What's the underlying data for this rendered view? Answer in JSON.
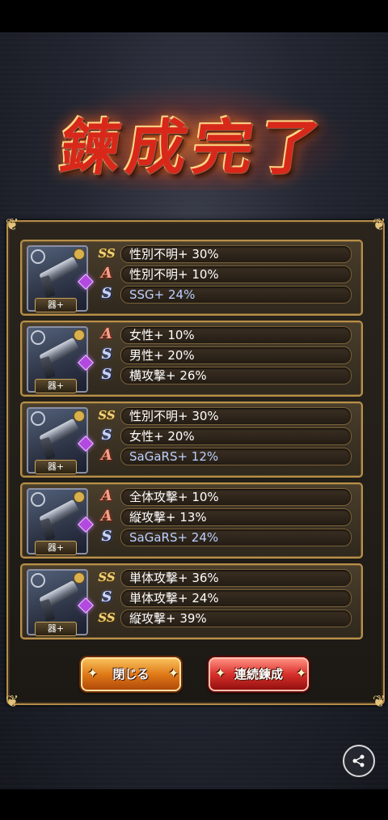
{
  "title": "鍊成完了",
  "cards": [
    {
      "thumb_label": "器+",
      "effects": [
        {
          "rank": "SS",
          "text": "性別不明+ 30%"
        },
        {
          "rank": "A",
          "text": "性別不明+ 10%"
        },
        {
          "rank": "S",
          "text": "SSG+ 24%"
        }
      ]
    },
    {
      "thumb_label": "器+",
      "effects": [
        {
          "rank": "A",
          "text": "女性+ 10%"
        },
        {
          "rank": "S",
          "text": "男性+ 20%"
        },
        {
          "rank": "S",
          "text": "横攻撃+ 26%"
        }
      ]
    },
    {
      "thumb_label": "器+",
      "effects": [
        {
          "rank": "SS",
          "text": "性別不明+ 30%"
        },
        {
          "rank": "S",
          "text": "女性+ 20%"
        },
        {
          "rank": "A",
          "text": "SaGaRS+ 12%"
        }
      ]
    },
    {
      "thumb_label": "器+",
      "effects": [
        {
          "rank": "A",
          "text": "全体攻撃+ 10%"
        },
        {
          "rank": "A",
          "text": "縦攻撃+ 13%"
        },
        {
          "rank": "S",
          "text": "SaGaRS+ 24%"
        }
      ]
    },
    {
      "thumb_label": "器+",
      "effects": [
        {
          "rank": "SS",
          "text": "単体攻撃+ 36%"
        },
        {
          "rank": "S",
          "text": "単体攻撃+ 24%"
        },
        {
          "rank": "SS",
          "text": "縦攻撃+ 39%"
        }
      ]
    }
  ],
  "buttons": {
    "close_label": "閉じる",
    "again_label": "連続鍊成"
  },
  "icons": {
    "share": "share-icon",
    "weapon": "pistol-icon",
    "gem": "gem-icon"
  },
  "colors": {
    "gold_border": "#b89048",
    "close_button": "#e07a18",
    "again_button": "#d8302c",
    "title_red": "#d8281a"
  }
}
